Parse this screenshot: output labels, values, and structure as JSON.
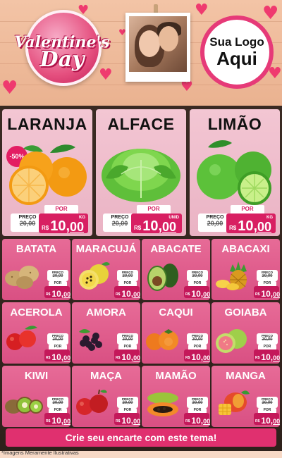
{
  "header": {
    "badge_line1": "Valentine's",
    "badge_line2": "Day",
    "logo_line1": "Sua Logo",
    "logo_line2": "Aqui"
  },
  "big_products": [
    {
      "name": "LARANJA",
      "discount": "-50%",
      "preco_label": "PREÇO",
      "old_price": "20,00",
      "por_label": "POR",
      "currency": "R$",
      "price_int": "10,",
      "price_dec": "00",
      "unit": "KG"
    },
    {
      "name": "ALFACE",
      "preco_label": "PREÇO",
      "old_price": "20,00",
      "por_label": "POR",
      "currency": "R$",
      "price_int": "10,",
      "price_dec": "00",
      "unit": "UNID"
    },
    {
      "name": "LIMÃO",
      "preco_label": "PREÇO",
      "old_price": "20,00",
      "por_label": "POR",
      "currency": "R$",
      "price_int": "10,",
      "price_dec": "00",
      "unit": "KG"
    }
  ],
  "small_products": [
    {
      "name": "BATATA",
      "preco_label": "PREÇO",
      "old_price": "20,00",
      "por_label": "POR",
      "currency": "R$",
      "price_int": "10,",
      "price_dec": "00"
    },
    {
      "name": "MARACUJÁ",
      "preco_label": "PREÇO",
      "old_price": "20,00",
      "por_label": "POR",
      "currency": "R$",
      "price_int": "10,",
      "price_dec": "00"
    },
    {
      "name": "ABACATE",
      "preco_label": "PREÇO",
      "old_price": "20,00",
      "por_label": "POR",
      "currency": "R$",
      "price_int": "10,",
      "price_dec": "00"
    },
    {
      "name": "ABACAXI",
      "preco_label": "PREÇO",
      "old_price": "20,00",
      "por_label": "POR",
      "currency": "R$",
      "price_int": "10,",
      "price_dec": "00"
    },
    {
      "name": "ACEROLA",
      "preco_label": "PREÇO",
      "old_price": "20,00",
      "por_label": "POR",
      "currency": "R$",
      "price_int": "10,",
      "price_dec": "00"
    },
    {
      "name": "AMORA",
      "preco_label": "PREÇO",
      "old_price": "20,00",
      "por_label": "POR",
      "currency": "R$",
      "price_int": "10,",
      "price_dec": "00"
    },
    {
      "name": "CAQUI",
      "preco_label": "PREÇO",
      "old_price": "20,00",
      "por_label": "POR",
      "currency": "R$",
      "price_int": "10,",
      "price_dec": "00"
    },
    {
      "name": "GOIABA",
      "preco_label": "PREÇO",
      "old_price": "20,00",
      "por_label": "POR",
      "currency": "R$",
      "price_int": "10,",
      "price_dec": "00"
    },
    {
      "name": "KIWI",
      "preco_label": "PREÇO",
      "old_price": "20,00",
      "por_label": "POR",
      "currency": "R$",
      "price_int": "10,",
      "price_dec": "00"
    },
    {
      "name": "MAÇA",
      "preco_label": "PREÇO",
      "old_price": "20,00",
      "por_label": "POR",
      "currency": "R$",
      "price_int": "10,",
      "price_dec": "00"
    },
    {
      "name": "MAMÃO",
      "preco_label": "PREÇO",
      "old_price": "20,00",
      "por_label": "POR",
      "currency": "R$",
      "price_int": "10,",
      "price_dec": "00"
    },
    {
      "name": "MANGA",
      "preco_label": "PREÇO",
      "old_price": "20,00",
      "por_label": "POR",
      "currency": "R$",
      "price_int": "10,",
      "price_dec": "00"
    }
  ],
  "footer": {
    "cta": "Crie seu encarte com este tema!",
    "disclaimer": "*Imagens Meramente Ilustrativas"
  },
  "colors": {
    "accent": "#e0306f",
    "price_bg": "#d81f62",
    "board": "#2e211b",
    "big_card": "#f3c6d3",
    "small_card": "#e76b97"
  },
  "icons": {
    "big": [
      "orange-fruit-icon",
      "lettuce-icon",
      "lime-icon"
    ],
    "small": [
      "potato-icon",
      "passion-fruit-icon",
      "avocado-icon",
      "pineapple-icon",
      "acerola-icon",
      "blackberry-icon",
      "persimmon-icon",
      "guava-icon",
      "kiwi-icon",
      "apple-icon",
      "papaya-icon",
      "mango-icon"
    ]
  }
}
